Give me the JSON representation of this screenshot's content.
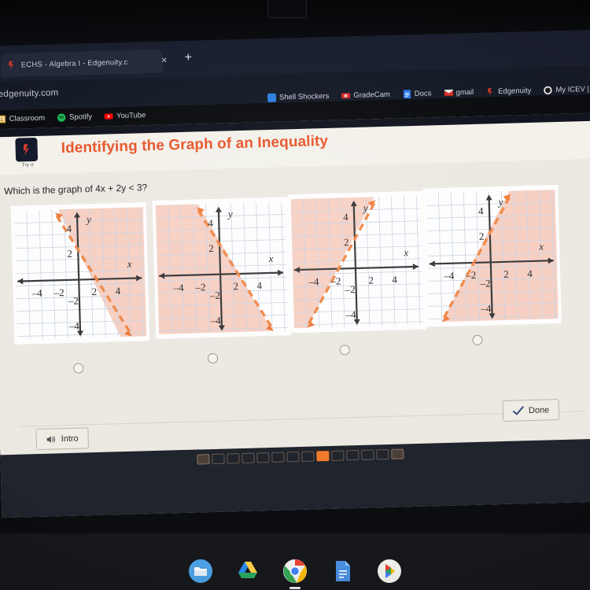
{
  "browser": {
    "tab": {
      "title": "ECHS - Algebra I - Edgenuity.c",
      "favicon": "edgenuity-favicon",
      "close_label": "×",
      "new_tab_label": "+"
    },
    "omnibox": {
      "url": "edgenuity.com"
    },
    "bookmarks_top": [
      {
        "label": "Shell Shockers",
        "icon": "shell-shockers-icon",
        "color": "#2d7fe0"
      },
      {
        "label": "GradeCam",
        "icon": "gradecam-icon",
        "color": "#d22f2f"
      },
      {
        "label": "Docs",
        "icon": "google-docs-icon",
        "color": "#2f7df0"
      },
      {
        "label": "gmail",
        "icon": "gmail-icon",
        "color": "#d93025"
      },
      {
        "label": "Edgenuity",
        "icon": "edgenuity-icon",
        "color": "#e23b2e"
      },
      {
        "label": "My ICEV |",
        "icon": "icev-icon",
        "color": "#ffffff"
      }
    ],
    "bookmarks_bottom": [
      {
        "label": "Classroom",
        "icon": "google-classroom-icon",
        "color": "#f4b400"
      },
      {
        "label": "Spotify",
        "icon": "spotify-icon",
        "color": "#1db954"
      },
      {
        "label": "YouTube",
        "icon": "youtube-icon",
        "color": "#ff0000"
      }
    ]
  },
  "lesson": {
    "badge_icon": "edgenuity-flame-icon",
    "badge_caption": "Try it",
    "title": "Identifying the Graph of an Inequality",
    "title_color": "#e8562c",
    "question": "Which is the graph of 4x + 2y < 3?"
  },
  "chart_data": [
    {
      "id": "choice-a",
      "type": "line",
      "title": "",
      "xlabel": "x",
      "ylabel": "y",
      "xlim": [
        -5,
        5
      ],
      "ylim": [
        -5,
        5
      ],
      "xticks": [
        -4,
        -2,
        2,
        4
      ],
      "yticks": [
        -4,
        -2,
        2,
        4
      ],
      "grid": true,
      "line": {
        "slope": -2,
        "intercept": 1.5,
        "style": "dashed",
        "color": "#f08a4b",
        "arrows": "both"
      },
      "shading": {
        "region": "above-right",
        "color": "#f5c4b4"
      }
    },
    {
      "id": "choice-b",
      "type": "line",
      "title": "",
      "xlabel": "x",
      "ylabel": "y",
      "xlim": [
        -5,
        5
      ],
      "ylim": [
        -5,
        5
      ],
      "xticks": [
        -4,
        -2,
        2,
        4
      ],
      "yticks": [
        -4,
        -2,
        2,
        4
      ],
      "grid": true,
      "line": {
        "slope": -2,
        "intercept": 1.5,
        "style": "dashed",
        "color": "#f08a4b",
        "arrows": "both"
      },
      "shading": {
        "region": "below-left",
        "color": "#f5c4b4"
      }
    },
    {
      "id": "choice-c",
      "type": "line",
      "title": "",
      "xlabel": "x",
      "ylabel": "y",
      "xlim": [
        -5,
        5
      ],
      "ylim": [
        -5,
        5
      ],
      "xticks": [
        -4,
        -2,
        2,
        4
      ],
      "yticks": [
        -4,
        -2,
        2,
        4
      ],
      "grid": true,
      "line": {
        "slope": 2,
        "intercept": 1.5,
        "style": "dashed",
        "color": "#f08a4b",
        "arrows": "both"
      },
      "shading": {
        "region": "above-left",
        "color": "#f5c4b4"
      }
    },
    {
      "id": "choice-d",
      "type": "line",
      "title": "",
      "xlabel": "x",
      "ylabel": "y",
      "xlim": [
        -5,
        5
      ],
      "ylim": [
        -5,
        5
      ],
      "xticks": [
        -4,
        -2,
        2,
        4
      ],
      "yticks": [
        -4,
        -2,
        2,
        4
      ],
      "grid": true,
      "line": {
        "slope": 2,
        "intercept": 1.5,
        "style": "dashed",
        "color": "#f08a4b",
        "arrows": "both"
      },
      "shading": {
        "region": "below-right",
        "color": "#f5c4b4"
      }
    }
  ],
  "answers": {
    "options": [
      {
        "id": "choice-a",
        "selected": false
      },
      {
        "id": "choice-b",
        "selected": false
      },
      {
        "id": "choice-c",
        "selected": false
      },
      {
        "id": "choice-d",
        "selected": false
      }
    ]
  },
  "footer": {
    "intro_label": "Intro",
    "intro_icon": "speaker-icon",
    "done_label": "Done",
    "done_icon": "check-icon"
  },
  "progress": {
    "total_steps": 14,
    "current_index": 8,
    "accent": "#ef7b2b"
  },
  "shelf": {
    "apps": [
      {
        "name": "files-icon",
        "label": "Files",
        "active": false
      },
      {
        "name": "google-drive-icon",
        "label": "Drive",
        "active": false
      },
      {
        "name": "chrome-icon",
        "label": "Chrome",
        "active": true
      },
      {
        "name": "google-docs-icon",
        "label": "Docs",
        "active": false
      },
      {
        "name": "play-store-icon",
        "label": "Play Store",
        "active": false
      }
    ]
  }
}
